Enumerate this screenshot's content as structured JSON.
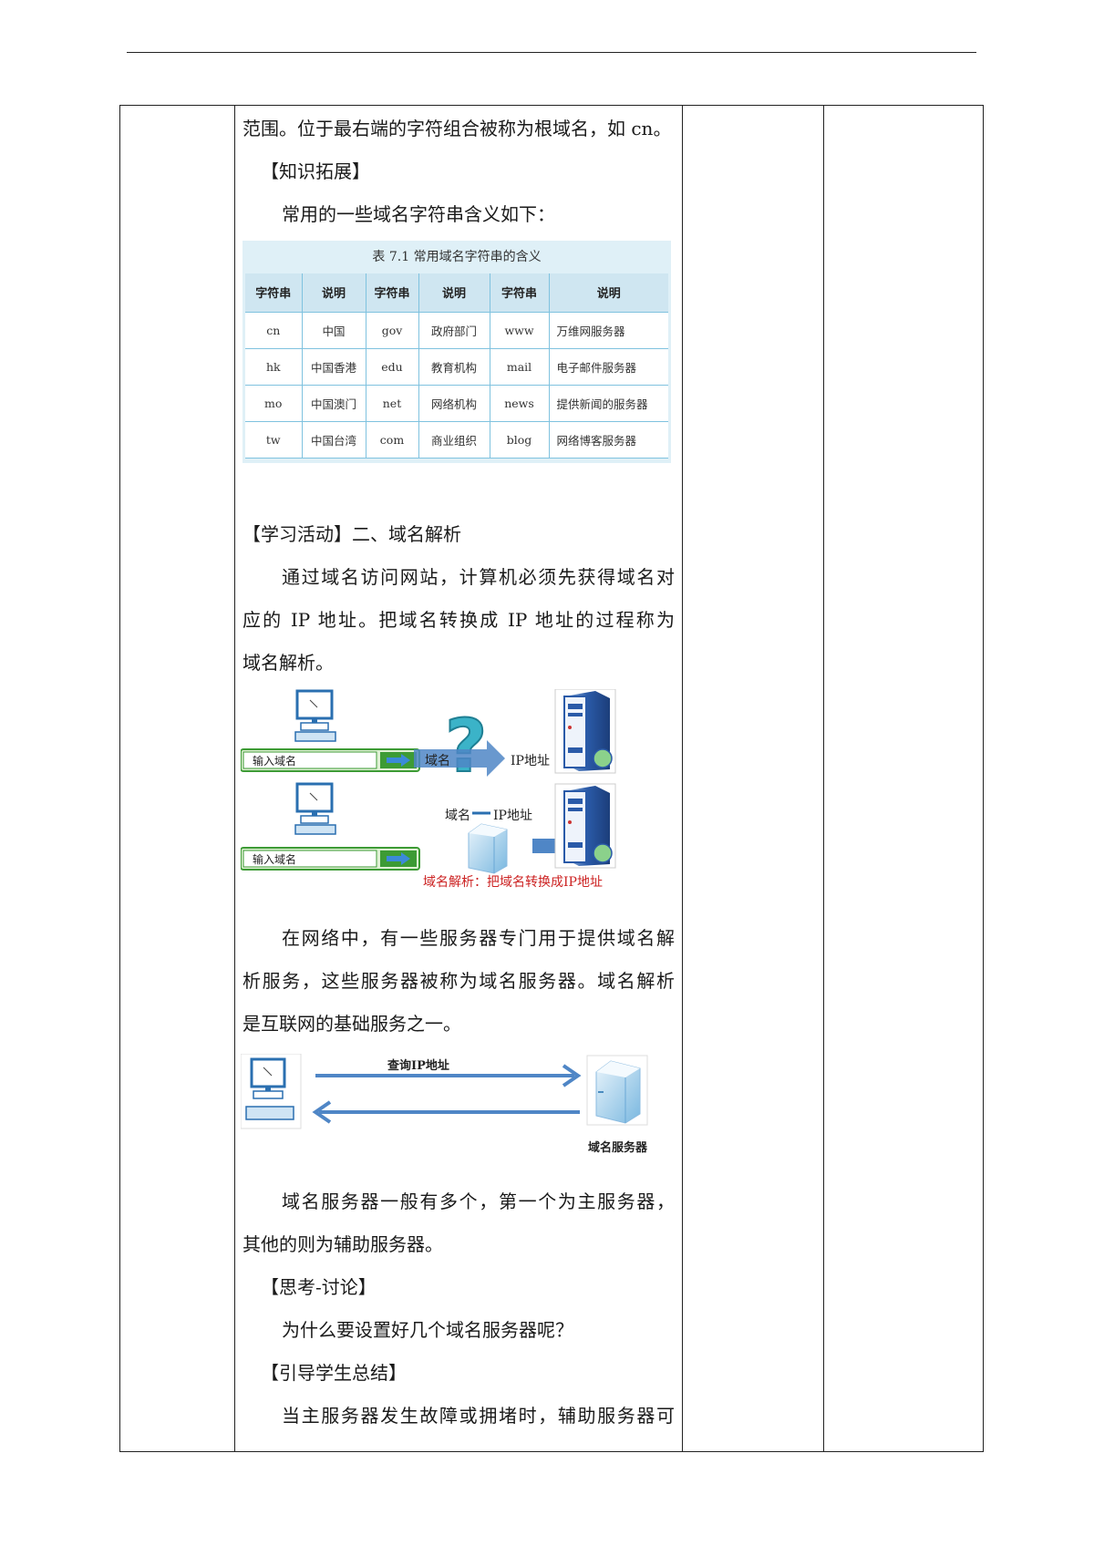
{
  "paragraphs": {
    "p1": "范围。位于最右端的字符组合被称为根域名，如 cn。",
    "p2": "【知识拓展】",
    "p3": "常用的一些域名字符串含义如下：",
    "p4": "【学习活动】二、域名解析",
    "p5a": "通过域名访问网站，计算机必须先获得域名对",
    "p5b": "应的 IP 地址。把域名转换成 IP 地址的过程称为",
    "p5c": "域名解析。",
    "p6a": "在网络中，有一些服务器专门用于提供域名解",
    "p6b": "析服务，这些服务器被称为域名服务器。域名解析",
    "p6c": "是互联网的基础服务之一。",
    "p7a": "域名服务器一般有多个，第一个为主服务器，",
    "p7b": "其他的则为辅助服务器。",
    "p8": "【思考-讨论】",
    "p9": "为什么要设置好几个域名服务器呢？",
    "p10": "【引导学生总结】",
    "p11": "当主服务器发生故障或拥堵时，辅助服务器可"
  },
  "domain_table": {
    "caption": "表 7.1    常用域名字符串的含义",
    "headers": [
      "字符串",
      "说明",
      "字符串",
      "说明",
      "字符串",
      "说明"
    ],
    "rows": [
      [
        "cn",
        "中国",
        "gov",
        "政府部门",
        "www",
        "万维网服务器"
      ],
      [
        "hk",
        "中国香港",
        "edu",
        "教育机构",
        "mail",
        "电子邮件服务器"
      ],
      [
        "mo",
        "中国澳门",
        "net",
        "网络机构",
        "news",
        "提供新闻的服务器"
      ],
      [
        "tw",
        "中国台湾",
        "com",
        "商业组织",
        "blog",
        "网络博客服务器"
      ]
    ]
  },
  "figure1": {
    "input_label_1": "输入域名",
    "input_label_2": "输入域名",
    "domain_label": "域名",
    "ip_label": "IP地址",
    "mapping_label_a": "域名",
    "mapping_label_b": "IP地址",
    "caption": "域名解析：把域名转换成IP地址"
  },
  "figure2": {
    "query_label": "查询IP地址",
    "server_label": "域名服务器"
  },
  "colors": {
    "table_bg": "#dff0f7",
    "table_border": "#7fc2df",
    "arrow_blue": "#4f86c6",
    "green": "#3d9b35",
    "caption_red": "#cc2222"
  }
}
